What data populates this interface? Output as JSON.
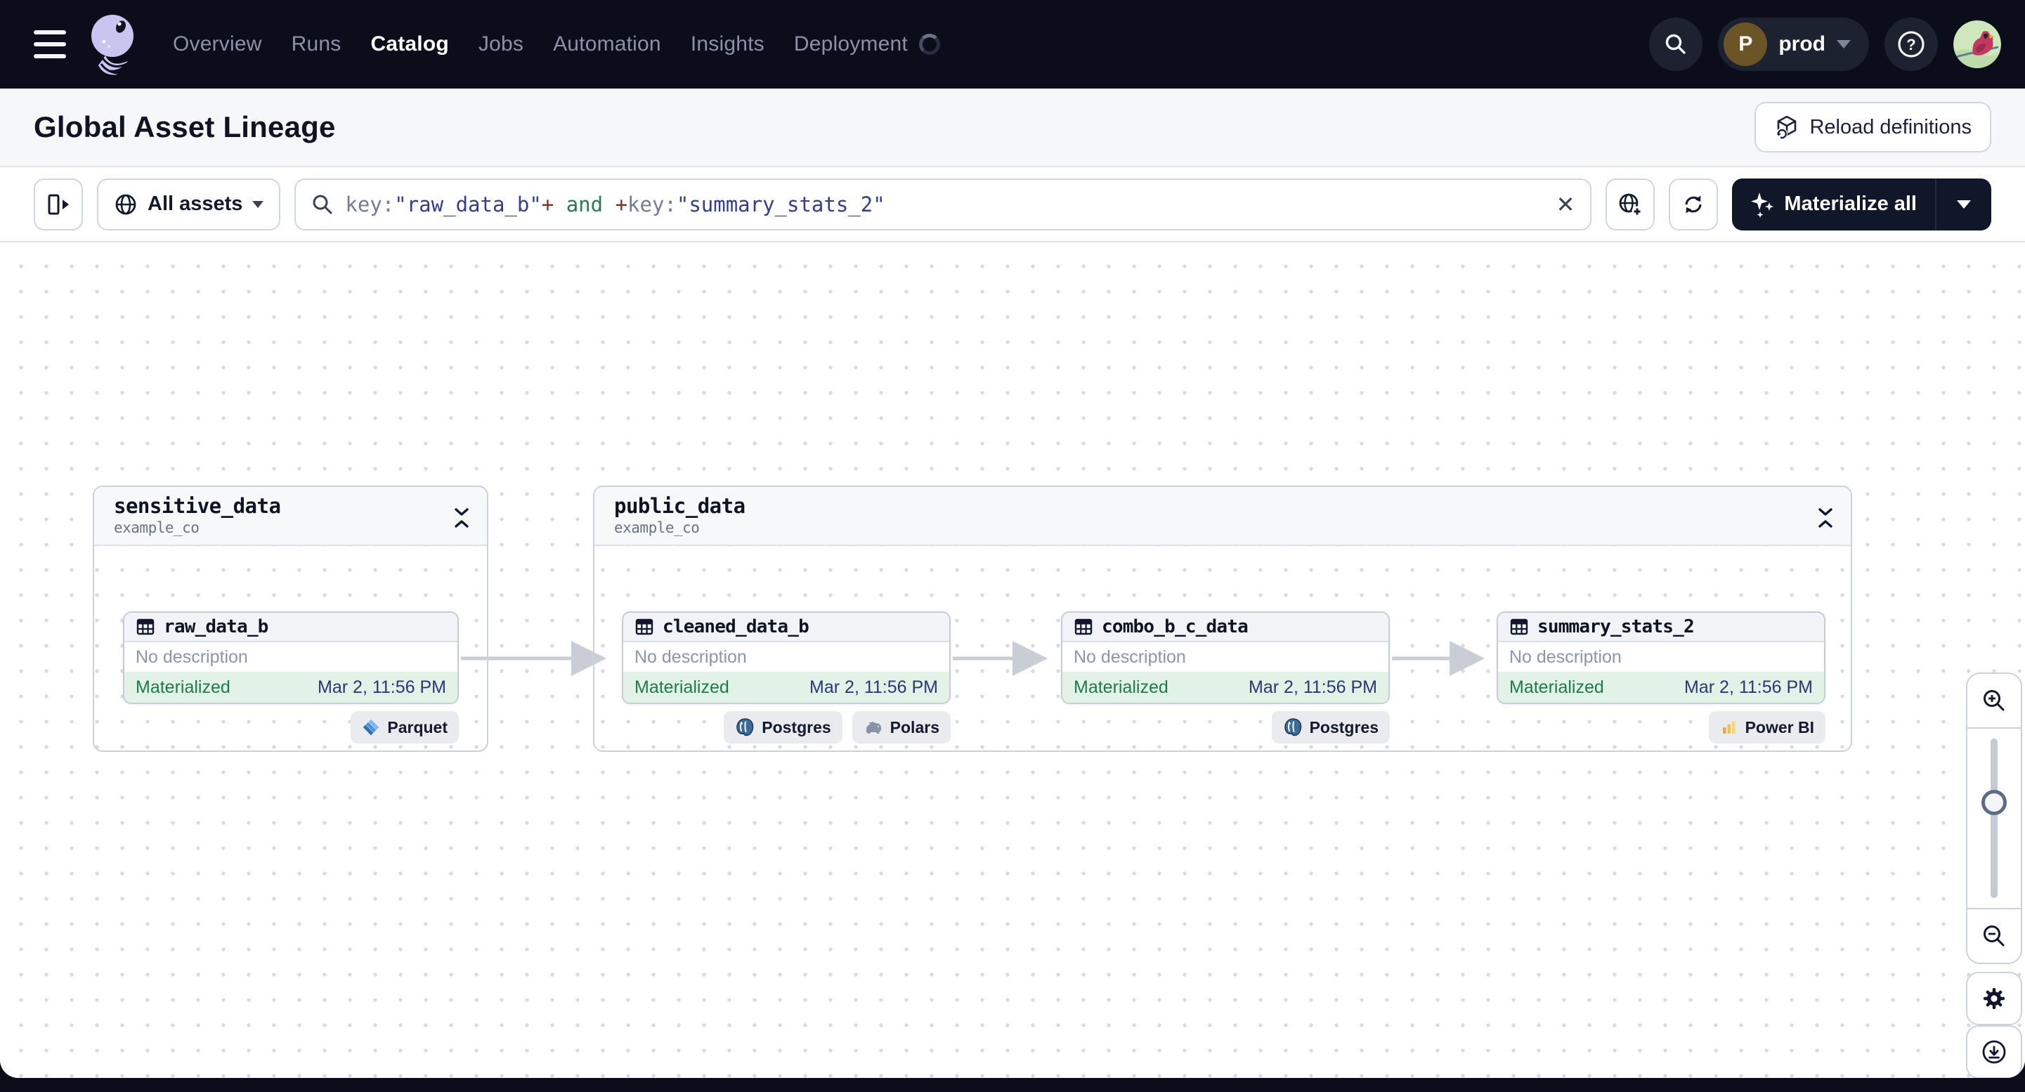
{
  "nav": {
    "items": [
      {
        "label": "Overview"
      },
      {
        "label": "Runs"
      },
      {
        "label": "Catalog",
        "active": true
      },
      {
        "label": "Jobs"
      },
      {
        "label": "Automation"
      },
      {
        "label": "Insights"
      },
      {
        "label": "Deployment",
        "loading": true
      }
    ],
    "environment": {
      "initial": "P",
      "name": "prod"
    }
  },
  "header": {
    "title": "Global Asset Lineage",
    "reload_button": "Reload definitions"
  },
  "toolbar": {
    "scope_button": "All assets",
    "search": {
      "segments": [
        {
          "kind": "key",
          "text": "key:"
        },
        {
          "kind": "string",
          "text": "\"raw_data_b\""
        },
        {
          "kind": "operator",
          "text": "+"
        },
        {
          "kind": "logic",
          "text": " and "
        },
        {
          "kind": "operator",
          "text": "+"
        },
        {
          "kind": "key",
          "text": "key:"
        },
        {
          "kind": "string",
          "text": "\"summary_stats_2\""
        }
      ]
    },
    "clear_label": "✕",
    "materialize_button": "Materialize all"
  },
  "graph": {
    "groups": [
      {
        "name": "sensitive_data",
        "location": "example_co"
      },
      {
        "name": "public_data",
        "location": "example_co"
      }
    ],
    "nodes": [
      {
        "name": "raw_data_b",
        "description": "No description",
        "status": "Materialized",
        "timestamp": "Mar 2, 11:56 PM",
        "tags": [
          "Parquet"
        ]
      },
      {
        "name": "cleaned_data_b",
        "description": "No description",
        "status": "Materialized",
        "timestamp": "Mar 2, 11:56 PM",
        "tags": [
          "Postgres",
          "Polars"
        ]
      },
      {
        "name": "combo_b_c_data",
        "description": "No description",
        "status": "Materialized",
        "timestamp": "Mar 2, 11:56 PM",
        "tags": [
          "Postgres"
        ]
      },
      {
        "name": "summary_stats_2",
        "description": "No description",
        "status": "Materialized",
        "timestamp": "Mar 2, 11:56 PM",
        "tags": [
          "Power BI"
        ]
      }
    ]
  },
  "colors": {
    "nav_bg": "#0b0e1a",
    "accent_dark": "#101729",
    "materialized_green": "#1e7a4c",
    "materialized_bg": "#e3f2e7",
    "timestamp_blue": "#2b3674",
    "query_string": "#333e8e",
    "query_operator": "#7c372a",
    "query_logic": "#2d7a4e"
  }
}
